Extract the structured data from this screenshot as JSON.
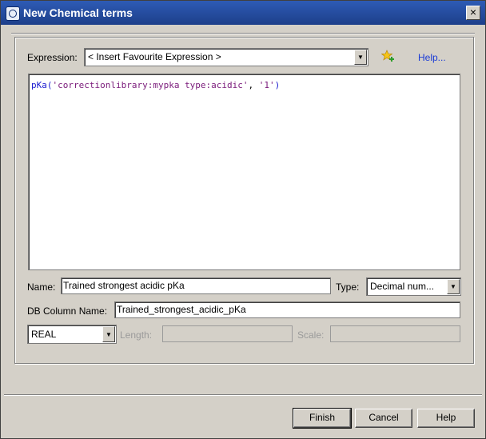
{
  "window": {
    "title": "New Chemical terms",
    "close_glyph": "×"
  },
  "expression": {
    "label": "Expression:",
    "combo_value": "< Insert Favourite Expression >",
    "help_link": "Help...",
    "code_fn": "pKa",
    "code_rest_open": "(",
    "code_arg1": "'correctionlibrary:mypka type:acidic'",
    "code_sep": ", ",
    "code_arg2": "'1'",
    "code_close": ")"
  },
  "name": {
    "label": "Name:",
    "value": "Trained strongest acidic pKa"
  },
  "type": {
    "label": "Type:",
    "value": "Decimal num..."
  },
  "db_column": {
    "label": "DB Column Name:",
    "value": "Trained_strongest_acidic_pKa"
  },
  "sql_type": {
    "value": "REAL"
  },
  "length": {
    "label": "Length:",
    "value": ""
  },
  "scale": {
    "label": "Scale:",
    "value": ""
  },
  "buttons": {
    "finish": "Finish",
    "cancel": "Cancel",
    "help": "Help"
  },
  "icons": {
    "app": "database-icon",
    "favourite": "star-add-icon",
    "arrow": "chevron-down-icon"
  },
  "colors": {
    "titlebar": "#1d3f8a",
    "link": "#1a3bd6",
    "code_function": "#1b1bd0",
    "code_string": "#7a1a7a"
  }
}
